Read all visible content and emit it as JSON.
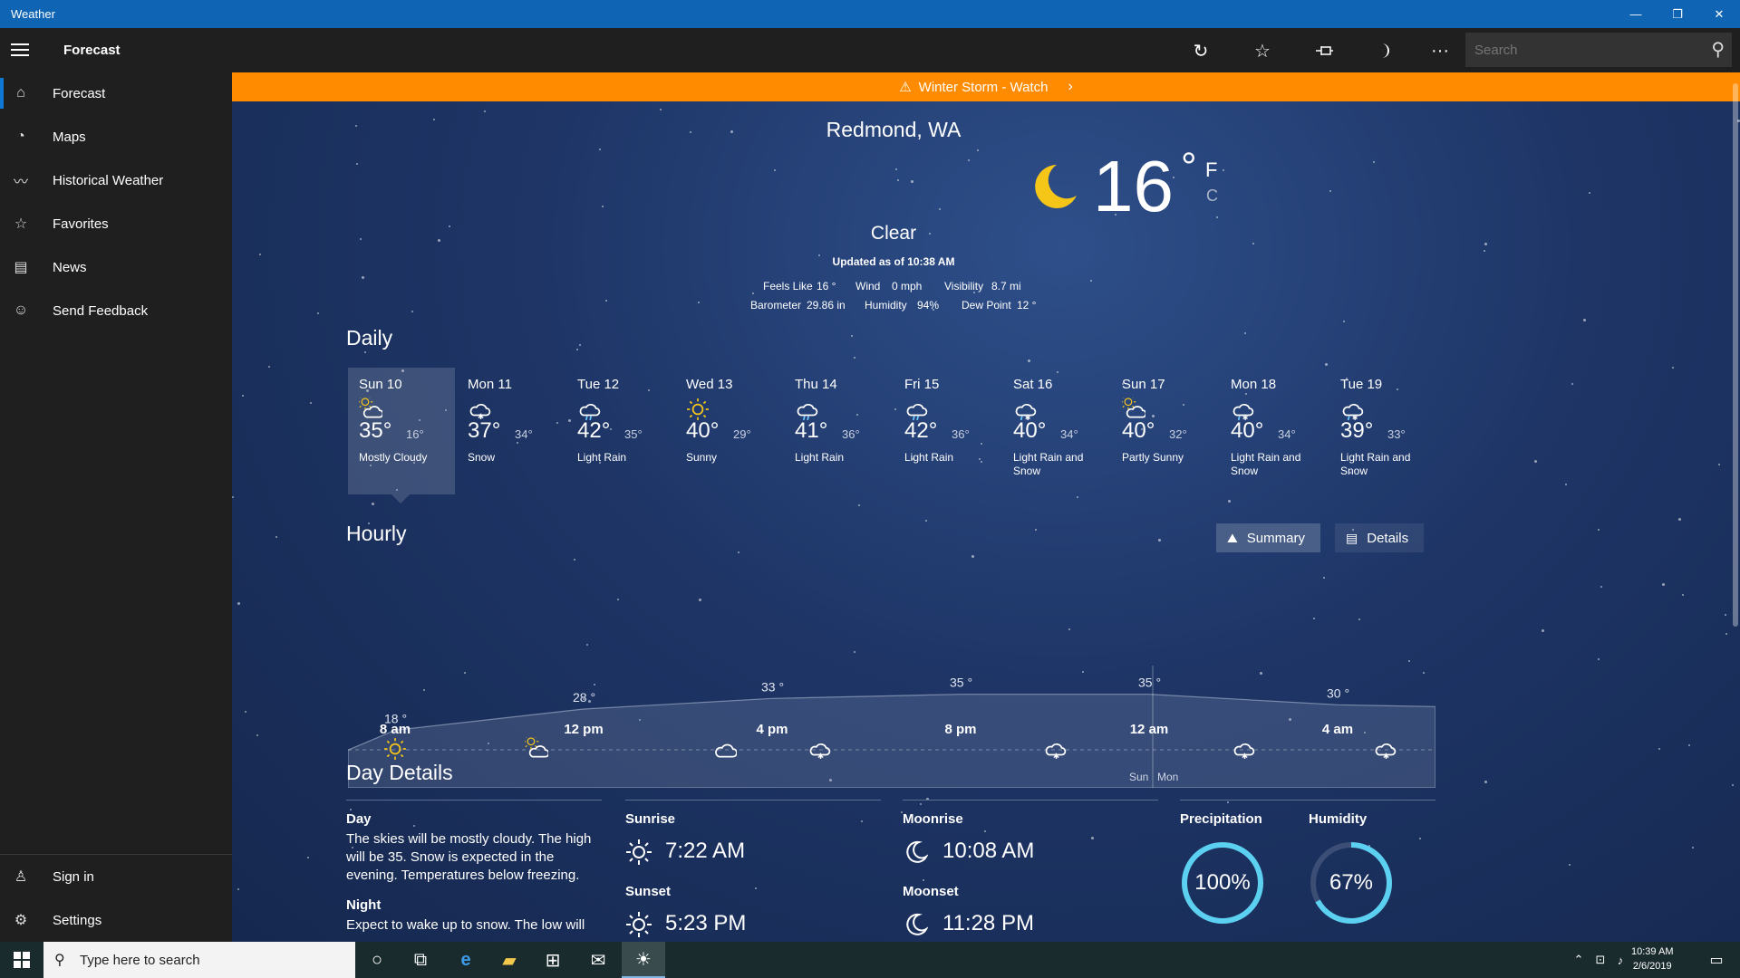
{
  "window": {
    "title": "Weather",
    "minimize": "—",
    "maximize": "❐",
    "close": "✕"
  },
  "appbar": {
    "title": "Forecast",
    "search_placeholder": "Search"
  },
  "sidebar": {
    "items": [
      {
        "label": "Forecast",
        "icon": "home-icon"
      },
      {
        "label": "Maps",
        "icon": "radar-icon"
      },
      {
        "label": "Historical Weather",
        "icon": "chart-icon"
      },
      {
        "label": "Favorites",
        "icon": "star-list-icon"
      },
      {
        "label": "News",
        "icon": "news-icon"
      },
      {
        "label": "Send Feedback",
        "icon": "smiley-icon"
      }
    ],
    "bottom": [
      {
        "label": "Sign in",
        "icon": "person-icon"
      },
      {
        "label": "Settings",
        "icon": "gear-icon"
      }
    ]
  },
  "alert": {
    "text": "Winter Storm - Watch",
    "color": "#ff8c00"
  },
  "current": {
    "location": "Redmond, WA",
    "temp": "16",
    "deg": "°",
    "unit_f": "F",
    "unit_c": "C",
    "condition": "Clear",
    "updated": "Updated as of 10:38 AM",
    "stats": {
      "feels_like_label": "Feels Like",
      "feels_like": "16 °",
      "wind_label": "Wind",
      "wind": "0 mph",
      "visibility_label": "Visibility",
      "visibility": "8.7 mi",
      "barometer_label": "Barometer",
      "barometer": "29.86 in",
      "humidity_label": "Humidity",
      "humidity": "94%",
      "dewpoint_label": "Dew Point",
      "dewpoint": "12 °"
    }
  },
  "daily": {
    "heading": "Daily",
    "days": [
      {
        "name": "Sun 10",
        "high": "35°",
        "low": "16°",
        "cond": "Mostly Cloudy",
        "icon": "partly-cloudy-icon"
      },
      {
        "name": "Mon 11",
        "high": "37°",
        "low": "34°",
        "cond": "Snow",
        "icon": "snow-icon"
      },
      {
        "name": "Tue 12",
        "high": "42°",
        "low": "35°",
        "cond": "Light Rain",
        "icon": "rain-icon"
      },
      {
        "name": "Wed 13",
        "high": "40°",
        "low": "29°",
        "cond": "Sunny",
        "icon": "sun-icon"
      },
      {
        "name": "Thu 14",
        "high": "41°",
        "low": "36°",
        "cond": "Light Rain",
        "icon": "rain-icon"
      },
      {
        "name": "Fri 15",
        "high": "42°",
        "low": "36°",
        "cond": "Light Rain",
        "icon": "rain-icon"
      },
      {
        "name": "Sat 16",
        "high": "40°",
        "low": "34°",
        "cond": "Light Rain and Snow",
        "icon": "rain-snow-icon"
      },
      {
        "name": "Sun 17",
        "high": "40°",
        "low": "32°",
        "cond": "Partly Sunny",
        "icon": "partly-sunny-icon"
      },
      {
        "name": "Mon 18",
        "high": "40°",
        "low": "34°",
        "cond": "Light Rain and Snow",
        "icon": "rain-snow-icon"
      },
      {
        "name": "Tue 19",
        "high": "39°",
        "low": "33°",
        "cond": "Light Rain and Snow",
        "icon": "rain-snow-icon"
      }
    ]
  },
  "hourly": {
    "heading": "Hourly",
    "summary_label": "Summary",
    "details_label": "Details",
    "time_labels": [
      "8 am",
      "12 pm",
      "4 pm",
      "8 pm",
      "12 am",
      "4 am"
    ],
    "day_split": [
      "Sun",
      "Mon"
    ]
  },
  "chart_data": {
    "type": "area",
    "x": [
      "8 am",
      "12 pm",
      "4 pm",
      "8 pm",
      "12 am",
      "4 am"
    ],
    "series": [
      {
        "values": [
          18,
          28,
          33,
          35,
          35,
          30
        ]
      }
    ],
    "point_labels": [
      "18 °",
      "28 °",
      "33 °",
      "35 °",
      "35 °",
      "30 °"
    ],
    "icons": [
      "sun-icon",
      "partly-sunny-icon",
      "cloud-icon",
      "snow-icon",
      "snow-icon",
      "snow-icon",
      "snow-icon"
    ]
  },
  "details": {
    "heading": "Day Details",
    "day_label": "Day",
    "day_text": "The skies will be mostly cloudy. The high will be 35. Snow is expected in the evening. Temperatures below freezing.",
    "night_label": "Night",
    "night_text": "Expect to wake up to snow. The low will",
    "sunrise_label": "Sunrise",
    "sunrise": "7:22 AM",
    "sunset_label": "Sunset",
    "sunset": "5:23 PM",
    "moonrise_label": "Moonrise",
    "moonrise": "10:08 AM",
    "moonset_label": "Moonset",
    "moonset": "11:28 PM",
    "precip_label": "Precipitation",
    "precip": "100%",
    "precip_value": 1.0,
    "humidity_label": "Humidity",
    "humidity": "67%",
    "humidity_value": 0.67
  },
  "taskbar": {
    "search_text": "Type here to search",
    "time": "10:39 AM",
    "date": "2/6/2019"
  }
}
